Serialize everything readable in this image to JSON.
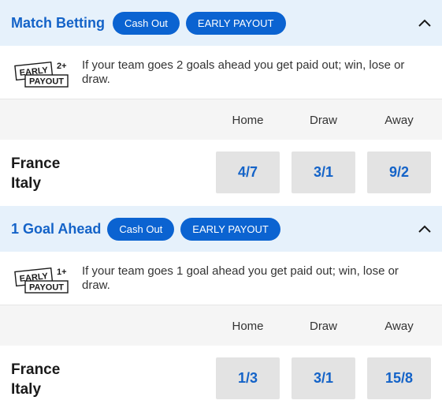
{
  "markets": [
    {
      "title": "Match Betting",
      "cash_out_label": "Cash Out",
      "early_payout_label": "EARLY PAYOUT",
      "badge": {
        "line1": "EARLY",
        "goals": "2+",
        "line2": "PAYOUT"
      },
      "info_text": "If your team goes 2 goals ahead you get paid out; win, lose or draw.",
      "columns": [
        "Home",
        "Draw",
        "Away"
      ],
      "teams": [
        "France",
        "Italy"
      ],
      "odds": [
        "4/7",
        "3/1",
        "9/2"
      ]
    },
    {
      "title": "1 Goal Ahead",
      "cash_out_label": "Cash Out",
      "early_payout_label": "EARLY PAYOUT",
      "badge": {
        "line1": "EARLY",
        "goals": "1+",
        "line2": "PAYOUT"
      },
      "info_text": "If your team goes 1 goal ahead you get paid out; win, lose or draw.",
      "columns": [
        "Home",
        "Draw",
        "Away"
      ],
      "teams": [
        "France",
        "Italy"
      ],
      "odds": [
        "1/3",
        "3/1",
        "15/8"
      ]
    }
  ],
  "icons": {
    "collapse": "chevron-up-icon"
  },
  "colors": {
    "accent": "#1463c8",
    "pill": "#0b63d1",
    "header_bg": "#e6f1fb",
    "odds_bg": "#e3e3e3"
  }
}
